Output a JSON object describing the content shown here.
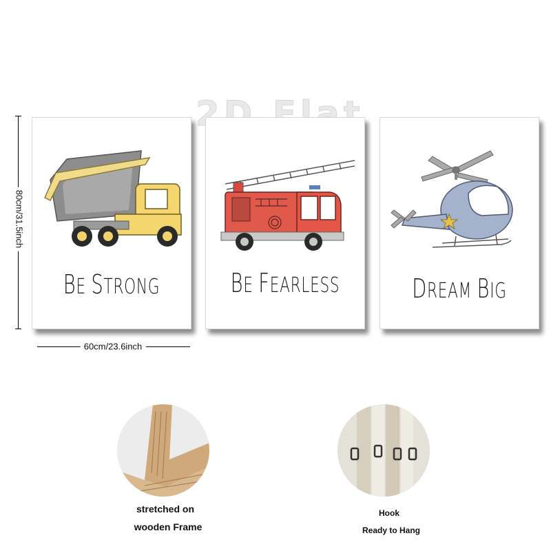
{
  "watermark": "2D Flat",
  "dimensions": {
    "height_label": "80cm/31.5inch",
    "width_label": "60cm/23.6inch"
  },
  "panels": [
    {
      "caption_first": "B",
      "caption_rest": "E ",
      "caption_second": "S",
      "caption_second_rest": "TRONG",
      "illustration": "dump-truck"
    },
    {
      "caption_first": "B",
      "caption_rest": "E ",
      "caption_second": "F",
      "caption_second_rest": "EARLESS",
      "illustration": "fire-truck"
    },
    {
      "caption_first": "D",
      "caption_rest": "REAM ",
      "caption_second": "B",
      "caption_second_rest": "IG",
      "illustration": "helicopter"
    }
  ],
  "details": [
    {
      "label_line1": "stretched on",
      "label_line2": "wooden Frame",
      "image": "wooden-frame-corner"
    },
    {
      "label_line1": "Hook",
      "label_line2": "Ready to Hang",
      "image": "hanging-hooks"
    }
  ]
}
